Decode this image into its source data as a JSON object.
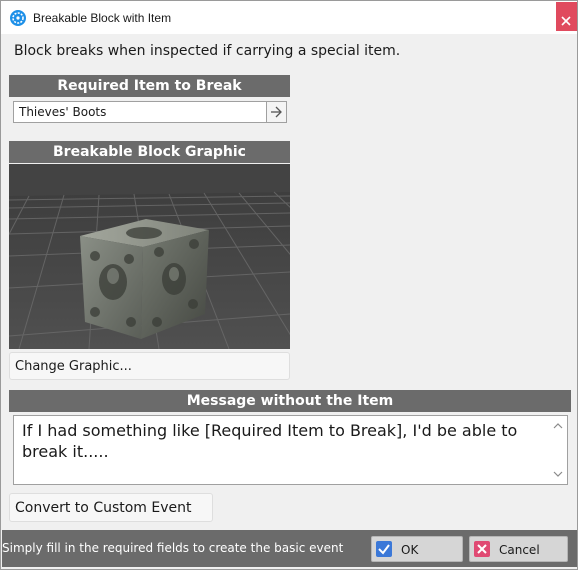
{
  "window": {
    "title": "Breakable Block with Item"
  },
  "description": "Block breaks when inspected if carrying a special item.",
  "required_item": {
    "header": "Required Item to Break",
    "value": "Thieves' Boots"
  },
  "graphic": {
    "header": "Breakable Block Graphic",
    "change_label": "Change Graphic..."
  },
  "message": {
    "header": "Message without the Item",
    "text": "If I had something like [Required Item to Break], I'd be able to break it....."
  },
  "convert_label": "Convert to Custom Event",
  "footer": {
    "hint": "Simply fill in the required fields to create the basic event",
    "ok_label": "OK",
    "cancel_label": "Cancel"
  },
  "colors": {
    "header_bg": "#6b6b6b",
    "close": "#e04a5e",
    "ok_icon": "#3b78d8",
    "cancel_icon": "#e04a73"
  }
}
